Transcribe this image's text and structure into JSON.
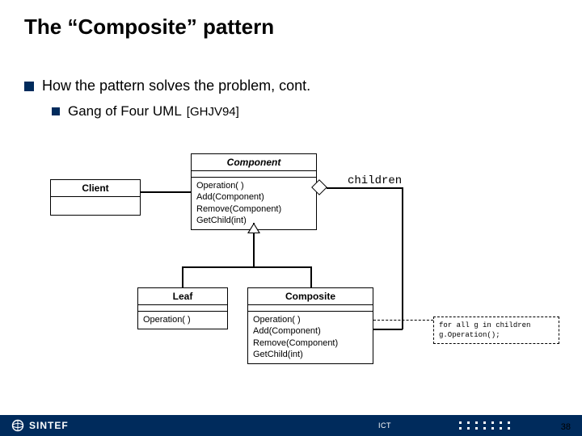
{
  "slide": {
    "title": "The “Composite” pattern",
    "bullet1": "How the pattern solves the problem, cont.",
    "bullet2": "Gang of Four UML",
    "ref": "[GHJV94]"
  },
  "uml": {
    "client": {
      "name": "Client"
    },
    "component": {
      "name": "Component",
      "ops": [
        "Operation( )",
        "Add(Component)",
        "Remove(Component)",
        "GetChild(int)"
      ]
    },
    "leaf": {
      "name": "Leaf",
      "ops": [
        "Operation( )"
      ]
    },
    "composite": {
      "name": "Composite",
      "ops": [
        "Operation( )",
        "Add(Component)",
        "Remove(Component)",
        "GetChild(int)"
      ]
    },
    "children_label": "children",
    "note": {
      "line1": "for all g in children",
      "line2": "  g.Operation();"
    }
  },
  "footer": {
    "brand": "SINTEF",
    "ict": "ICT",
    "page": "38"
  }
}
